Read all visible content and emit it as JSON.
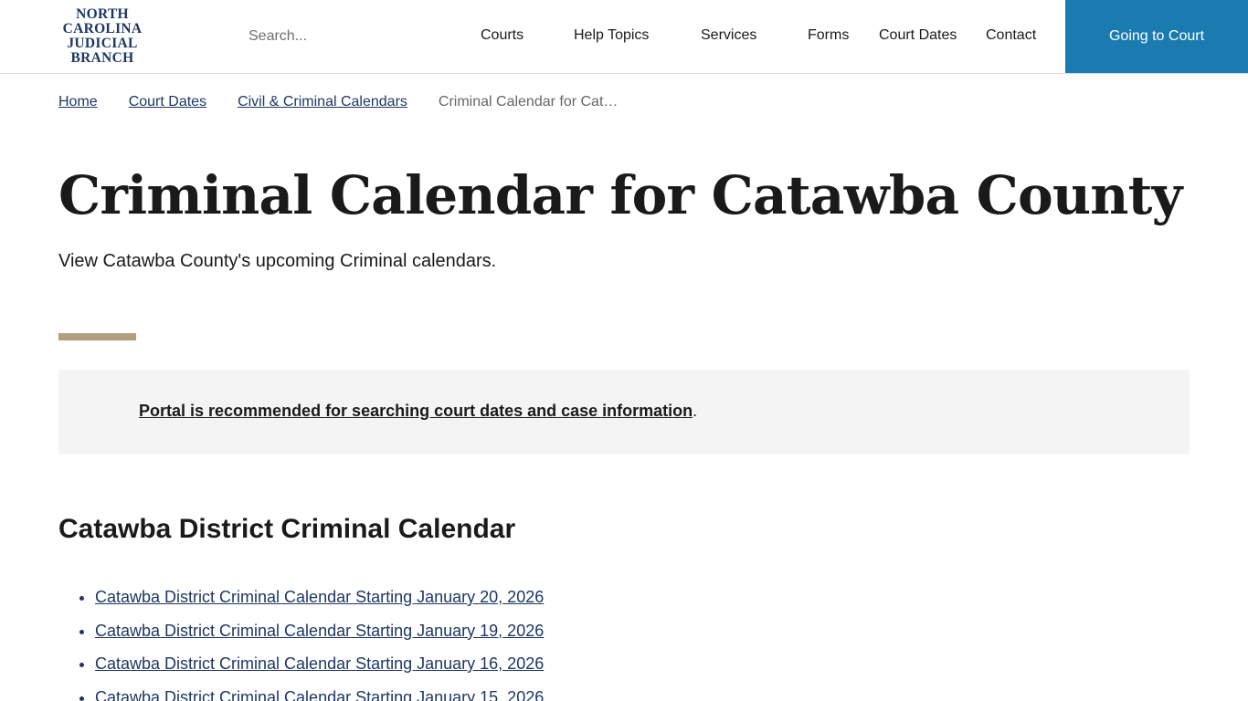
{
  "header": {
    "logo_lines": [
      "NORTH",
      "CAROLINA",
      "JUDICIAL",
      "BRANCH"
    ],
    "search_placeholder": "Search...",
    "nav": [
      "Courts",
      "Help Topics",
      "Services",
      "Forms",
      "Court Dates",
      "Contact"
    ],
    "cta_label": "Going to Court"
  },
  "breadcrumb": {
    "items": [
      "Home",
      "Court Dates",
      "Civil & Criminal Calendars"
    ],
    "current": "Criminal Calendar for Cat…"
  },
  "main": {
    "title": "Criminal Calendar for Catawba County",
    "intro": "View Catawba County's upcoming Criminal calendars.",
    "notice_link": "Portal is recommended for searching court dates and case information",
    "notice_suffix": ".",
    "section_heading": "Catawba District Criminal Calendar",
    "calendars": [
      "Catawba District Criminal Calendar Starting January 20, 2026",
      "Catawba District Criminal Calendar Starting January 19, 2026",
      "Catawba District Criminal Calendar Starting January 16, 2026",
      "Catawba District Criminal Calendar Starting January 15, 2026"
    ]
  },
  "colors": {
    "brand_navy": "#1d3763",
    "cta_blue": "#1a7bb0",
    "accent_tan": "#b39f7e",
    "notice_bg": "#f4f4f4"
  }
}
